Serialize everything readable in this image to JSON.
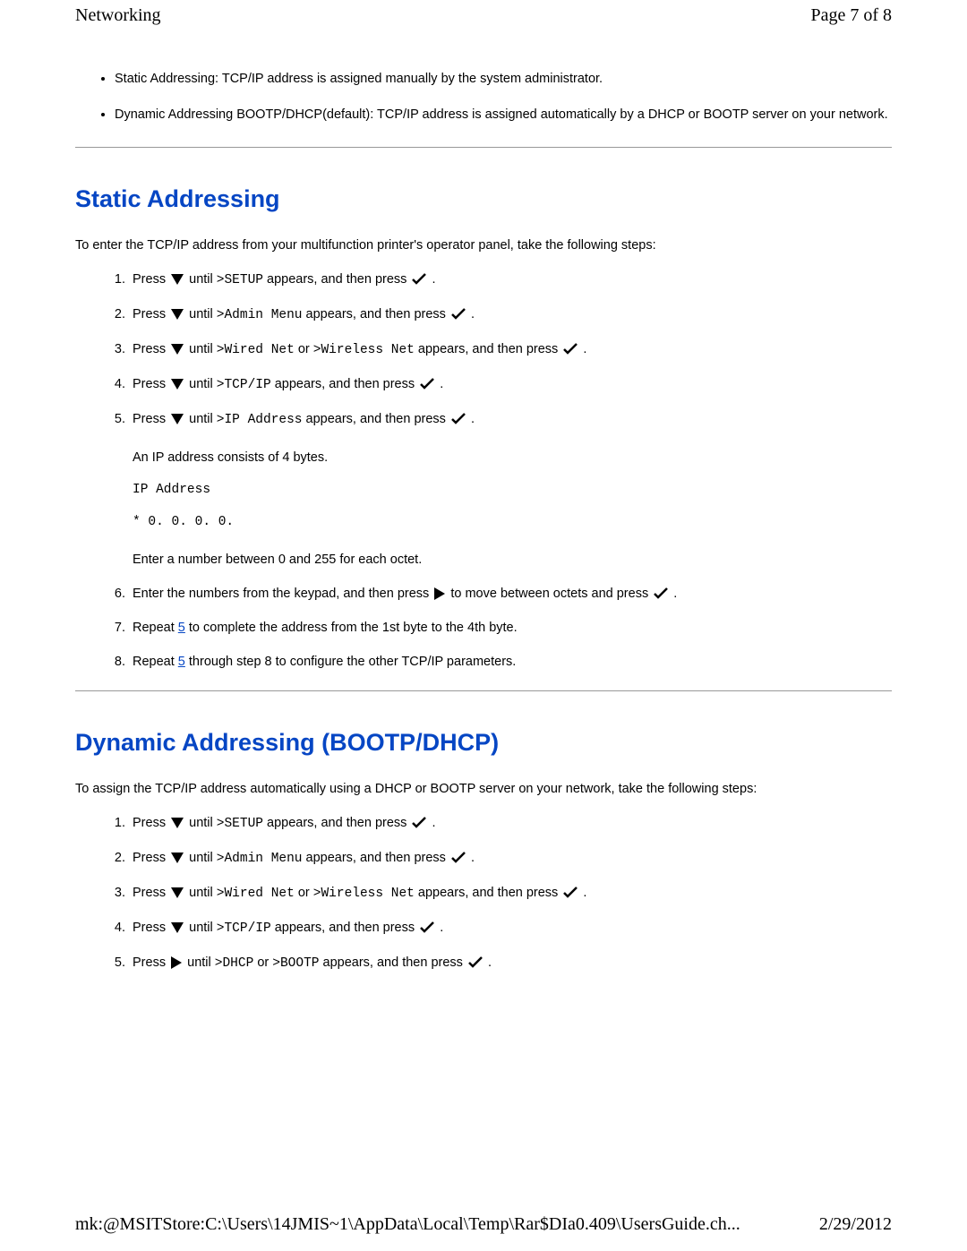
{
  "header": {
    "title": "Networking",
    "page_indicator": "Page 7 of 8"
  },
  "intro_bullets": [
    "Static Addressing: TCP/IP address is assigned manually by the system administrator.",
    "Dynamic Addressing BOOTP/DHCP(default): TCP/IP address is assigned automatically by a DHCP or BOOTP server on your network."
  ],
  "static": {
    "title": "Static Addressing",
    "lead": "To enter the TCP/IP address from your multifunction printer's operator panel, take the following steps:",
    "labels": {
      "press": "Press",
      "until": "until",
      "appears_press": "appears, and then press",
      "or": "or",
      "period": "."
    },
    "menus": {
      "setup": ">SETUP",
      "admin_menu": ">Admin Menu",
      "wired_net": ">Wired Net",
      "wireless_net": ">Wireless Net",
      "tcpip": ">TCP/IP",
      "ip_address": ">IP Address"
    },
    "step5_extra": {
      "line1": "An IP address consists of 4 bytes.",
      "code1": "IP Address",
      "code2": "* 0. 0. 0. 0.",
      "line2": "Enter a number between 0 and 255 for each octet."
    },
    "step6": {
      "pre": "Enter the numbers from the keypad, and then press",
      "mid": "to move between octets and press",
      "end": "."
    },
    "step7": {
      "pre": "Repeat ",
      "link": "5",
      "post": " to complete the address from the 1st byte to the 4th byte."
    },
    "step8": {
      "pre": "Repeat ",
      "link": "5",
      "post": " through step 8 to configure the other TCP/IP parameters."
    }
  },
  "dynamic": {
    "title": "Dynamic Addressing (BOOTP/DHCP)",
    "lead": "To assign the TCP/IP address automatically using a DHCP or BOOTP server on your network, take the following steps:",
    "labels": {
      "press": "Press",
      "until": "until",
      "appears_press": "appears, and then press",
      "or": "or",
      "period": "."
    },
    "menus": {
      "setup": ">SETUP",
      "admin_menu": ">Admin Menu",
      "wired_net": ">Wired Net",
      "wireless_net": ">Wireless Net",
      "tcpip": ">TCP/IP",
      "dhcp": ">DHCP",
      "bootp": ">BOOTP"
    }
  },
  "footer": {
    "path": "mk:@MSITStore:C:\\Users\\14JMIS~1\\AppData\\Local\\Temp\\Rar$DIa0.409\\UsersGuide.ch...",
    "date": "2/29/2012"
  }
}
